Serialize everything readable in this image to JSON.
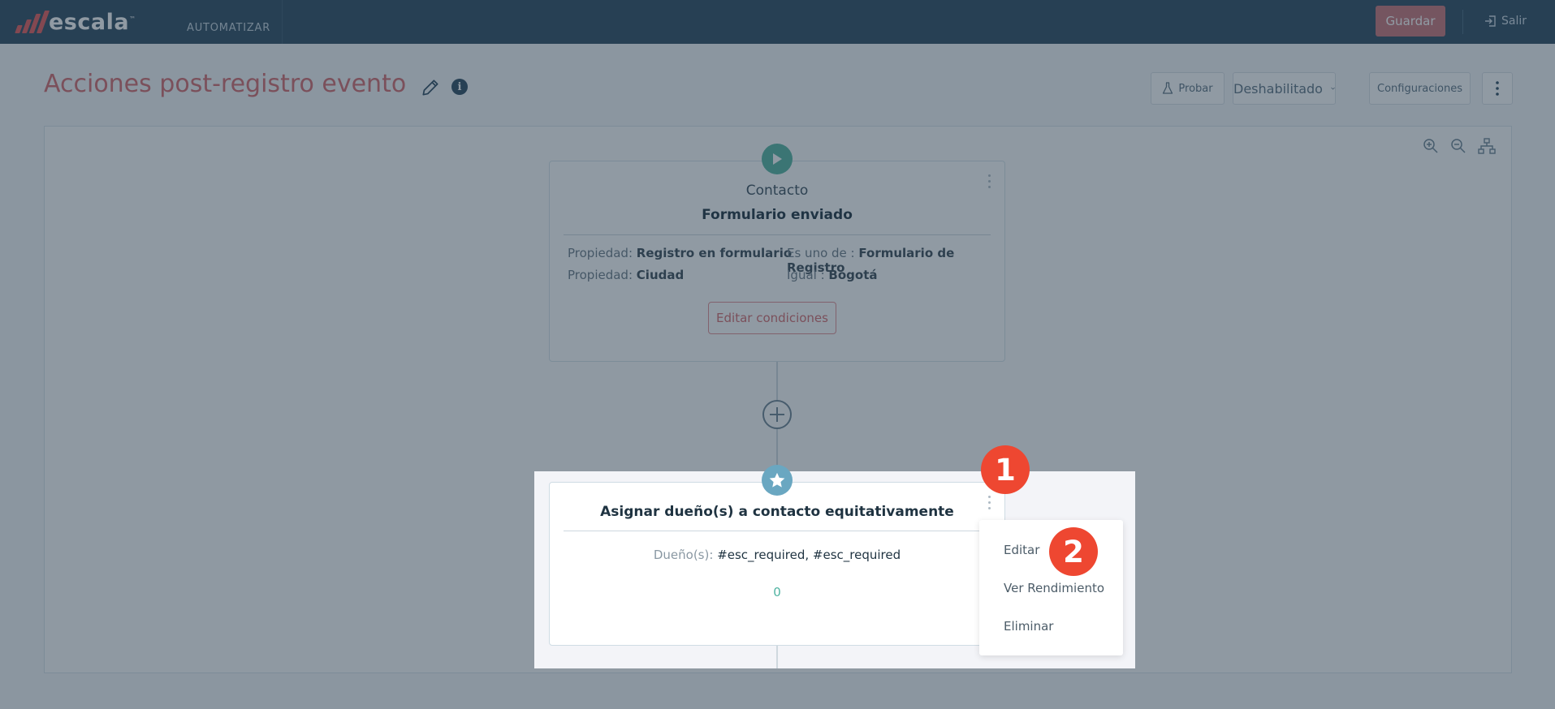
{
  "nav": {
    "brand": "escala",
    "brand_tm": "™",
    "section": "AUTOMATIZAR",
    "save_label": "Guardar",
    "exit_label": "Salir"
  },
  "header": {
    "title": "Acciones post-registro evento",
    "toolbar": {
      "test_label": "Probar",
      "status_label": "Deshabilitado",
      "config_label": "Configuraciones"
    }
  },
  "trigger": {
    "type": "Contacto",
    "name": "Formulario enviado",
    "conditions": [
      {
        "label": "Propiedad:",
        "value": "Registro en formulario"
      },
      {
        "label": "Es uno de :",
        "value": "Formulario de Registro"
      },
      {
        "label": "Propiedad:",
        "value": "Ciudad"
      },
      {
        "label": "Igual :",
        "value": "Bogotá"
      }
    ],
    "edit_label": "Editar condiciones"
  },
  "action": {
    "title": "Asignar dueño(s) a contacto equitativamente",
    "owners_label": "Dueño(s):",
    "owners_value": "#esc_required, #esc_required",
    "count": "0"
  },
  "context_menu": {
    "items": [
      "Editar",
      "Ver Rendimiento",
      "Eliminar"
    ]
  },
  "steps": [
    "1",
    "2"
  ],
  "colors": {
    "nav_bg": "#2d4a60",
    "accent": "#d46a6e",
    "save_bg": "#c97478",
    "trigger_badge": "#55b4a0",
    "action_badge": "#6aa7c1",
    "step_badge": "#ee4731"
  },
  "icons": {
    "logo": "escala-bars-icon",
    "exit": "sign-out-icon",
    "edit_title": "pencil-icon",
    "info": "info-icon",
    "test": "flask-icon",
    "status": "chevron-down-icon",
    "more": "vertical-dots-icon",
    "zoom_in": "zoom-in-icon",
    "zoom_out": "zoom-out-icon",
    "layout": "hierarchy-icon",
    "trigger": "play-icon",
    "add": "plus-circle-icon",
    "action": "star-icon"
  }
}
